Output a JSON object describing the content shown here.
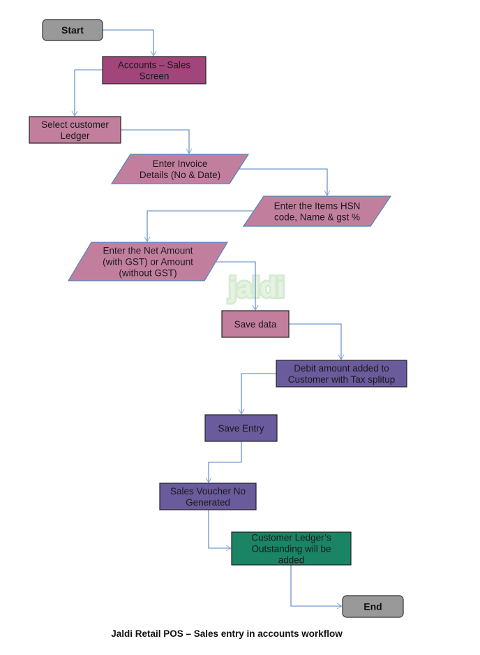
{
  "title": "Jaldi Retail POS – Sales entry in accounts workflow",
  "watermark": "jaldi",
  "colors": {
    "terminal": "#999999",
    "accounts": "#a2457b",
    "input_step": "#c27f9d",
    "system_step": "#6a5b9c",
    "result": "#1a8464",
    "connector": "#4f81bd"
  },
  "nodes": [
    {
      "id": "start",
      "shape": "terminal",
      "lines": [
        "Start"
      ]
    },
    {
      "id": "accounts",
      "shape": "process",
      "lines": [
        "Accounts – Sales",
        "Screen"
      ]
    },
    {
      "id": "select-ledger",
      "shape": "process",
      "lines": [
        "Select customer",
        "Ledger"
      ]
    },
    {
      "id": "invoice",
      "shape": "data",
      "lines": [
        "Enter Invoice",
        "Details (No & Date)"
      ]
    },
    {
      "id": "items",
      "shape": "data",
      "lines": [
        "Enter the Items HSN",
        "code, Name & gst %"
      ]
    },
    {
      "id": "net-amount",
      "shape": "data",
      "lines": [
        "Enter the Net Amount",
        "(with GST) or Amount",
        "(without GST)"
      ]
    },
    {
      "id": "save-data",
      "shape": "process",
      "lines": [
        "Save data"
      ]
    },
    {
      "id": "debit",
      "shape": "process",
      "lines": [
        "Debit amount added to",
        "Customer with Tax splitup"
      ]
    },
    {
      "id": "save-entry",
      "shape": "process",
      "lines": [
        "Save Entry"
      ]
    },
    {
      "id": "voucher",
      "shape": "process",
      "lines": [
        "Sales Voucher No",
        "Generated"
      ]
    },
    {
      "id": "outstanding",
      "shape": "process",
      "lines": [
        "Customer Ledger’s",
        "Outstanding will be",
        "added"
      ]
    },
    {
      "id": "end",
      "shape": "terminal",
      "lines": [
        "End"
      ]
    }
  ],
  "edges": [
    [
      "start",
      "accounts"
    ],
    [
      "accounts",
      "select-ledger"
    ],
    [
      "select-ledger",
      "invoice"
    ],
    [
      "invoice",
      "items"
    ],
    [
      "items",
      "net-amount"
    ],
    [
      "net-amount",
      "save-data"
    ],
    [
      "save-data",
      "debit"
    ],
    [
      "debit",
      "save-entry"
    ],
    [
      "save-entry",
      "voucher"
    ],
    [
      "voucher",
      "outstanding"
    ],
    [
      "outstanding",
      "end"
    ]
  ]
}
